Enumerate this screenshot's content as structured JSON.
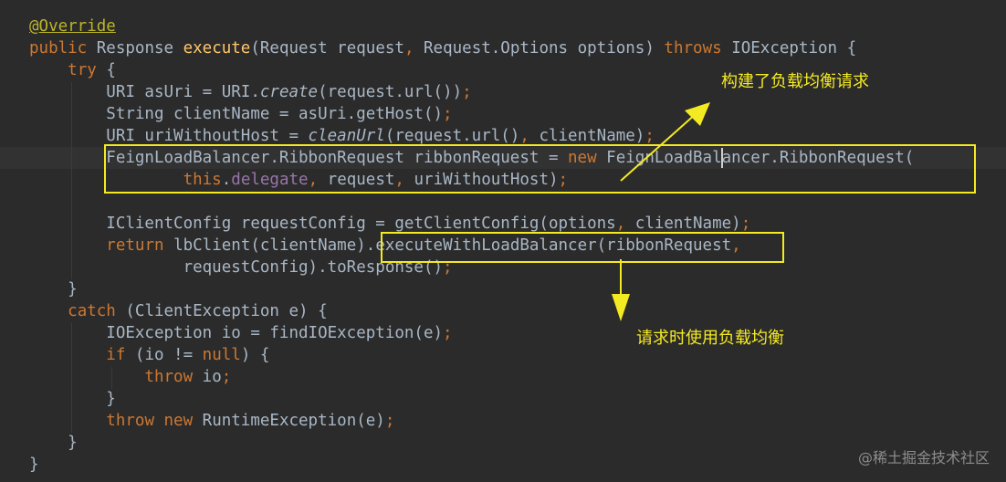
{
  "code_lines": [
    {
      "tokens": [
        {
          "t": "@Override",
          "c": "ann"
        }
      ]
    },
    {
      "tokens": [
        {
          "t": "public ",
          "c": "kw"
        },
        {
          "t": "Response ",
          "c": "plain"
        },
        {
          "t": "execute",
          "c": "fn"
        },
        {
          "t": "(Request request",
          "c": "plain"
        },
        {
          "t": ", ",
          "c": "punc"
        },
        {
          "t": "Request.Options options) ",
          "c": "plain"
        },
        {
          "t": "throws ",
          "c": "kw"
        },
        {
          "t": "IOException {",
          "c": "plain"
        }
      ]
    },
    {
      "tokens": [
        {
          "t": "    ",
          "c": "plain"
        },
        {
          "t": "try ",
          "c": "kw"
        },
        {
          "t": "{",
          "c": "plain"
        }
      ]
    },
    {
      "tokens": [
        {
          "t": "        URI asUri = URI.",
          "c": "plain"
        },
        {
          "t": "create",
          "c": "it"
        },
        {
          "t": "(request.url())",
          "c": "plain"
        },
        {
          "t": ";",
          "c": "punc"
        }
      ]
    },
    {
      "tokens": [
        {
          "t": "        String clientName = asUri.getHost()",
          "c": "plain"
        },
        {
          "t": ";",
          "c": "punc"
        }
      ]
    },
    {
      "tokens": [
        {
          "t": "        URI uriWithoutHost = ",
          "c": "plain"
        },
        {
          "t": "cleanUrl",
          "c": "it"
        },
        {
          "t": "(request.url()",
          "c": "plain"
        },
        {
          "t": ", ",
          "c": "punc"
        },
        {
          "t": "clientName)",
          "c": "plain"
        },
        {
          "t": ";",
          "c": "punc"
        }
      ]
    },
    {
      "current": true,
      "tokens": [
        {
          "t": "        FeignLoadBalancer.RibbonRequest ribbonRequest = ",
          "c": "plain"
        },
        {
          "t": "new ",
          "c": "kw"
        },
        {
          "t": "FeignLoadBalancer.RibbonRequest(",
          "c": "plain"
        }
      ]
    },
    {
      "tokens": [
        {
          "t": "                ",
          "c": "plain"
        },
        {
          "t": "this",
          "c": "kw"
        },
        {
          "t": ".",
          "c": "plain"
        },
        {
          "t": "delegate",
          "c": "field"
        },
        {
          "t": ", ",
          "c": "punc"
        },
        {
          "t": "request",
          "c": "plain"
        },
        {
          "t": ", ",
          "c": "punc"
        },
        {
          "t": "uriWithoutHost)",
          "c": "plain"
        },
        {
          "t": ";",
          "c": "punc"
        }
      ]
    },
    {
      "tokens": []
    },
    {
      "tokens": [
        {
          "t": "        IClientConfig requestConfig = getClientConfig(options",
          "c": "plain"
        },
        {
          "t": ", ",
          "c": "punc"
        },
        {
          "t": "clientName)",
          "c": "plain"
        },
        {
          "t": ";",
          "c": "punc"
        }
      ]
    },
    {
      "tokens": [
        {
          "t": "        ",
          "c": "plain"
        },
        {
          "t": "return ",
          "c": "kw"
        },
        {
          "t": "lbClient(clientName).executeWithLoadBalancer(ribbonRequest",
          "c": "plain"
        },
        {
          "t": ",",
          "c": "punc"
        }
      ]
    },
    {
      "tokens": [
        {
          "t": "                requestConfig).toResponse()",
          "c": "plain"
        },
        {
          "t": ";",
          "c": "punc"
        }
      ]
    },
    {
      "tokens": [
        {
          "t": "    }",
          "c": "plain"
        }
      ]
    },
    {
      "tokens": [
        {
          "t": "    ",
          "c": "plain"
        },
        {
          "t": "catch ",
          "c": "kw"
        },
        {
          "t": "(ClientException e) {",
          "c": "plain"
        }
      ]
    },
    {
      "tokens": [
        {
          "t": "        IOException io = findIOException(e)",
          "c": "plain"
        },
        {
          "t": ";",
          "c": "punc"
        }
      ]
    },
    {
      "tokens": [
        {
          "t": "        ",
          "c": "plain"
        },
        {
          "t": "if ",
          "c": "kw"
        },
        {
          "t": "(io != ",
          "c": "plain"
        },
        {
          "t": "null",
          "c": "kw"
        },
        {
          "t": ") {",
          "c": "plain"
        }
      ]
    },
    {
      "tokens": [
        {
          "t": "            ",
          "c": "plain"
        },
        {
          "t": "throw ",
          "c": "kw"
        },
        {
          "t": "io",
          "c": "plain"
        },
        {
          "t": ";",
          "c": "punc"
        }
      ]
    },
    {
      "tokens": [
        {
          "t": "        }",
          "c": "plain"
        }
      ]
    },
    {
      "tokens": [
        {
          "t": "        ",
          "c": "plain"
        },
        {
          "t": "throw new ",
          "c": "kw"
        },
        {
          "t": "RuntimeException(e)",
          "c": "plain"
        },
        {
          "t": ";",
          "c": "punc"
        }
      ]
    },
    {
      "tokens": [
        {
          "t": "    }",
          "c": "plain"
        }
      ]
    },
    {
      "tokens": [
        {
          "t": "}",
          "c": "plain"
        }
      ]
    }
  ],
  "annotations": {
    "box1_label": "构建了负载均衡请求",
    "box2_label": "请求时使用负载均衡"
  },
  "watermark": "@稀土掘金技术社区",
  "colors": {
    "background": "#2b2b2b",
    "current_line": "#323232",
    "keyword": "#cc7832",
    "annotation": "#bbb529",
    "method_decl": "#ffc66d",
    "field": "#9876aa",
    "plain": "#a9b7c6",
    "highlight": "#f4ea22"
  }
}
